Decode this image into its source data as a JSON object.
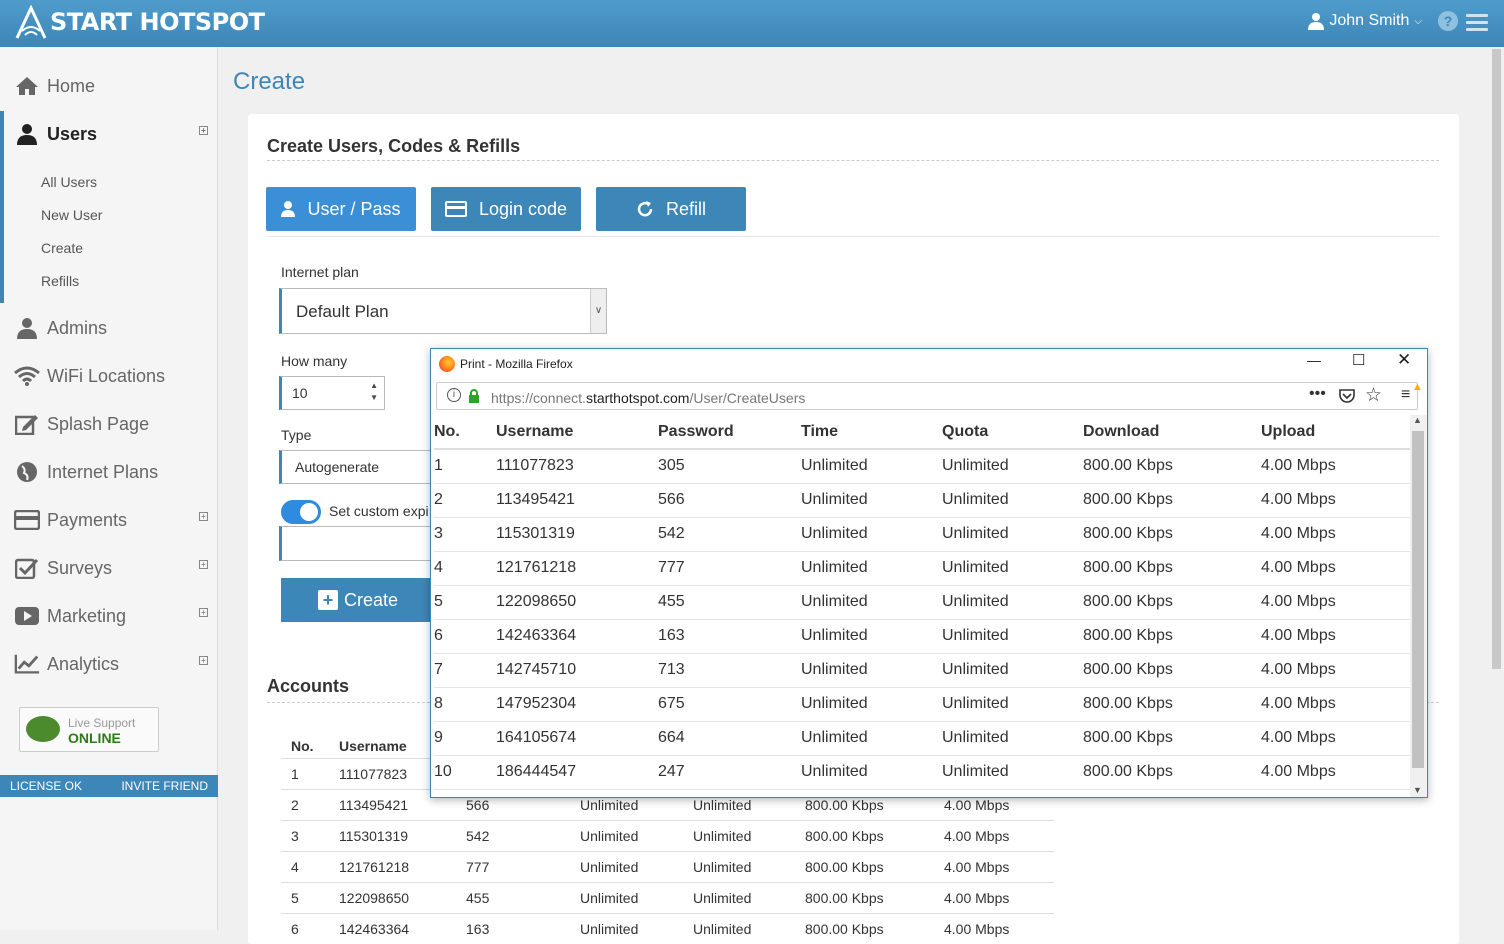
{
  "app": {
    "logo_text": "START HOTSPOT",
    "user_name": "John Smith",
    "help_glyph": "?"
  },
  "sidebar": {
    "items": [
      {
        "label": "Home",
        "icon": "home-icon"
      },
      {
        "label": "Users",
        "icon": "user-icon"
      },
      {
        "label": "Admins",
        "icon": "user-icon"
      },
      {
        "label": "WiFi Locations",
        "icon": "wifi-icon"
      },
      {
        "label": "Splash Page",
        "icon": "edit-icon"
      },
      {
        "label": "Internet Plans",
        "icon": "globe-icon"
      },
      {
        "label": "Payments",
        "icon": "credit-card-icon"
      },
      {
        "label": "Surveys",
        "icon": "checkbox-icon"
      },
      {
        "label": "Marketing",
        "icon": "play-icon"
      },
      {
        "label": "Analytics",
        "icon": "chart-icon"
      }
    ],
    "sub_items": [
      "All Users",
      "New User",
      "Create",
      "Refills"
    ],
    "support": {
      "line1": "Live Support",
      "line2": "ONLINE"
    },
    "license": "LICENSE OK",
    "invite": "INVITE FRIEND"
  },
  "page": {
    "title": "Create"
  },
  "panel": {
    "title": "Create Users, Codes & Refills",
    "tabs": [
      "User / Pass",
      "Login code",
      "Refill"
    ],
    "plan_label": "Internet plan",
    "plan_value": "Default Plan",
    "howmany_label": "How many",
    "howmany_value": "10",
    "type_label": "Type",
    "type_value": "Autogenerate",
    "custom_expiry_label": "Set custom expi",
    "create_label": "Create",
    "accounts_title": "Accounts"
  },
  "accounts_table": {
    "headers": [
      "No.",
      "Username"
    ],
    "rows": [
      [
        "1",
        "111077823",
        "",
        "",
        "",
        "",
        ""
      ],
      [
        "2",
        "113495421",
        "566",
        "Unlimited",
        "Unlimited",
        "800.00 Kbps",
        "4.00 Mbps"
      ],
      [
        "3",
        "115301319",
        "542",
        "Unlimited",
        "Unlimited",
        "800.00 Kbps",
        "4.00 Mbps"
      ],
      [
        "4",
        "121761218",
        "777",
        "Unlimited",
        "Unlimited",
        "800.00 Kbps",
        "4.00 Mbps"
      ],
      [
        "5",
        "122098650",
        "455",
        "Unlimited",
        "Unlimited",
        "800.00 Kbps",
        "4.00 Mbps"
      ],
      [
        "6",
        "142463364",
        "163",
        "Unlimited",
        "Unlimited",
        "800.00 Kbps",
        "4.00 Mbps"
      ]
    ]
  },
  "print_window": {
    "title": "Print - Mozilla Firefox",
    "url_prefix": "https://connect.",
    "url_domain": "starthotspot.com",
    "url_path": "/User/CreateUsers",
    "headers": [
      "No.",
      "Username",
      "Password",
      "Time",
      "Quota",
      "Download",
      "Upload"
    ],
    "rows": [
      [
        "1",
        "111077823",
        "305",
        "Unlimited",
        "Unlimited",
        "800.00 Kbps",
        "4.00 Mbps"
      ],
      [
        "2",
        "113495421",
        "566",
        "Unlimited",
        "Unlimited",
        "800.00 Kbps",
        "4.00 Mbps"
      ],
      [
        "3",
        "115301319",
        "542",
        "Unlimited",
        "Unlimited",
        "800.00 Kbps",
        "4.00 Mbps"
      ],
      [
        "4",
        "121761218",
        "777",
        "Unlimited",
        "Unlimited",
        "800.00 Kbps",
        "4.00 Mbps"
      ],
      [
        "5",
        "122098650",
        "455",
        "Unlimited",
        "Unlimited",
        "800.00 Kbps",
        "4.00 Mbps"
      ],
      [
        "6",
        "142463364",
        "163",
        "Unlimited",
        "Unlimited",
        "800.00 Kbps",
        "4.00 Mbps"
      ],
      [
        "7",
        "142745710",
        "713",
        "Unlimited",
        "Unlimited",
        "800.00 Kbps",
        "4.00 Mbps"
      ],
      [
        "8",
        "147952304",
        "675",
        "Unlimited",
        "Unlimited",
        "800.00 Kbps",
        "4.00 Mbps"
      ],
      [
        "9",
        "164105674",
        "664",
        "Unlimited",
        "Unlimited",
        "800.00 Kbps",
        "4.00 Mbps"
      ],
      [
        "10",
        "186444547",
        "247",
        "Unlimited",
        "Unlimited",
        "800.00 Kbps",
        "4.00 Mbps"
      ]
    ]
  },
  "colors": {
    "brand": "#3d86b8",
    "tab_active": "#3a8fd6",
    "online": "#2f7a1a"
  }
}
